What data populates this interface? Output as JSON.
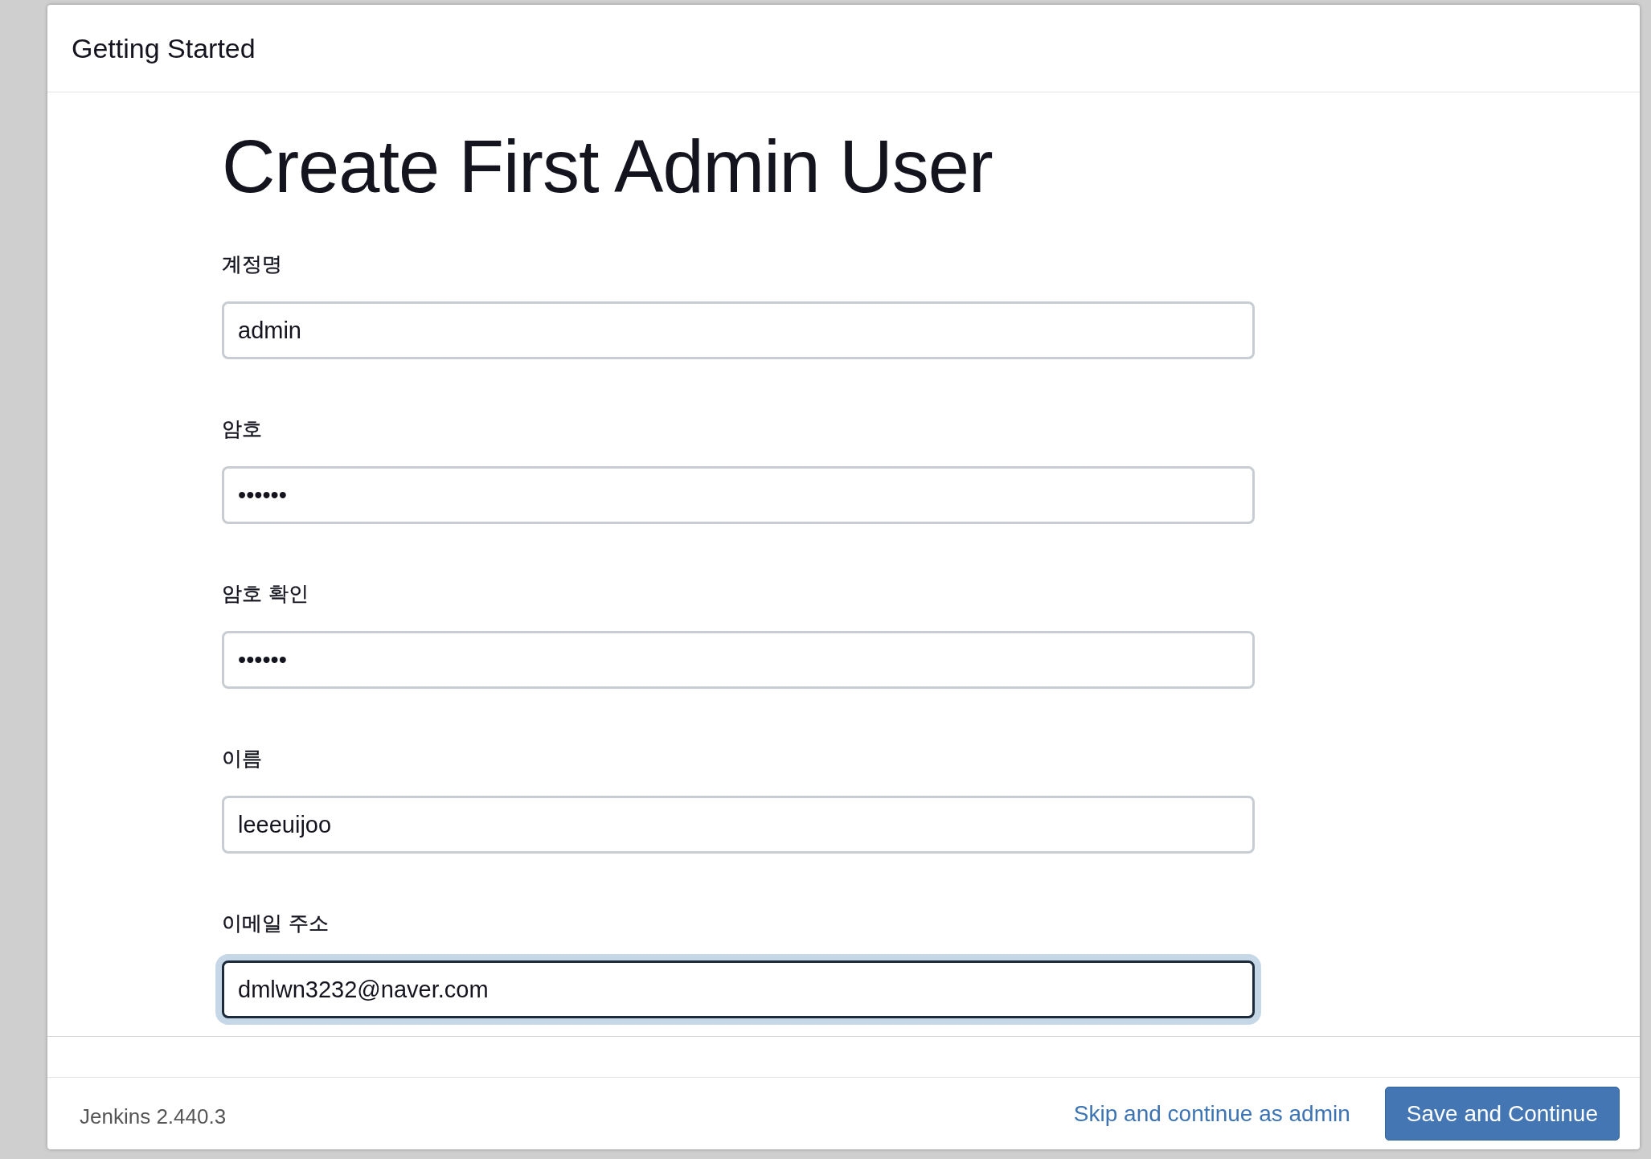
{
  "window": {
    "title": "Getting Started"
  },
  "heading": "Create First Admin User",
  "fields": [
    {
      "label": "계정명",
      "value": "admin",
      "focused": false
    },
    {
      "label": "암호",
      "value": "••••••",
      "focused": false
    },
    {
      "label": "암호 확인",
      "value": "••••••",
      "focused": false
    },
    {
      "label": "이름",
      "value": "leeeuijoo",
      "focused": false
    },
    {
      "label": "이메일 주소",
      "value": "dmlwn3232@naver.com",
      "focused": true
    }
  ],
  "footer": {
    "version": "Jenkins 2.440.3",
    "skip_link": "Skip and continue as admin",
    "save_button": "Save and Continue"
  }
}
